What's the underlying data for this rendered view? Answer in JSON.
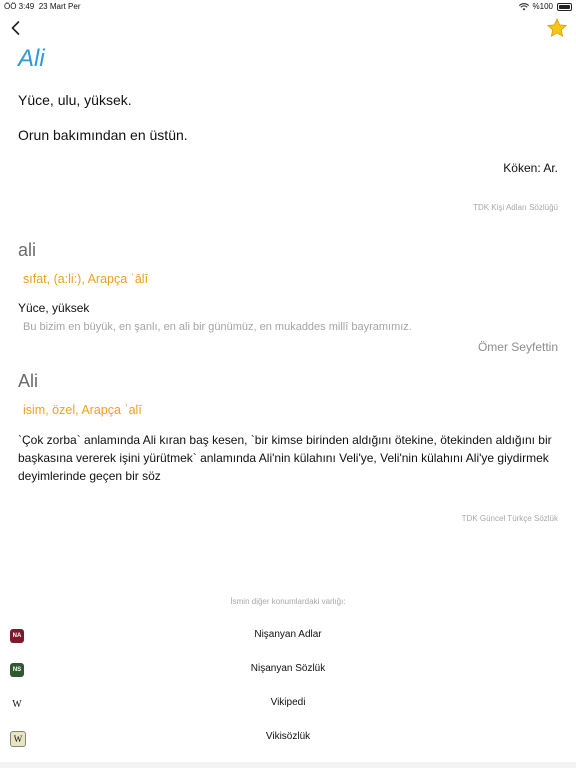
{
  "status": {
    "time": "ÖÖ 3:49",
    "date": "23 Mart Per",
    "battery": "%100"
  },
  "entry1": {
    "title": "Ali",
    "meaning1": "Yüce, ulu, yüksek.",
    "meaning2": "Orun bakımından en üstün.",
    "origin": "Köken: Ar.",
    "source": "TDK Kişi Adları Sözlüğü"
  },
  "entry2": {
    "headword": "ali",
    "grammar": "sıfat, (a:li:), Arapça ʿālī",
    "definition": "Yüce, yüksek",
    "example": "Bu bizim en büyük, en şanlı, en ali bir günümüz, en mukaddes millî bayramımız.",
    "author": "Ömer Seyfettin"
  },
  "entry3": {
    "headword": "Ali",
    "grammar": "isim, özel, Arapça ʿalī",
    "definition": "`Çok zorba` anlamında Ali kıran baş kesen, `bir kimse birinden aldığını ötekine, ötekinden aldığını bir başkasına vererek işini yürütmek` anlamında Ali'nin külahını Veli'ye, Veli'nin külahını Ali'ye giydirmek deyimlerinde geçen bir söz",
    "source": "TDK Güncel Türkçe Sözlük"
  },
  "other": {
    "title": "İsmin diğer konumlardaki varlığı:",
    "links": [
      {
        "label": "Nişanyan Adlar",
        "icon_text": "NA",
        "icon": "nisanyan-adlar-icon",
        "bg": "#7a1a2b",
        "fg": "#ffffff"
      },
      {
        "label": "Nişanyan Sözlük",
        "icon_text": "NS",
        "icon": "nisanyan-sozluk-icon",
        "bg": "#2e5a2e",
        "fg": "#ffffff"
      },
      {
        "label": "Vikipedi",
        "icon_text": "W",
        "icon": "wikipedia-icon",
        "bg": "#ffffff",
        "fg": "#111111"
      },
      {
        "label": "Vikisözlük",
        "icon_text": "W",
        "icon": "wiktionary-icon",
        "bg": "#e8e4c8",
        "fg": "#111111"
      }
    ]
  },
  "colors": {
    "accent": "#2d9bdb",
    "grammar": "#f0a020",
    "star": "#f5c518"
  }
}
